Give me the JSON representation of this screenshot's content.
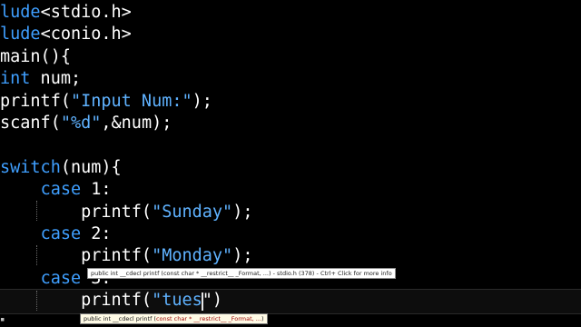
{
  "editor": {
    "lines": [
      {
        "prefix": "",
        "keyword": "lude",
        "rest": "<stdio.h>",
        "str": "",
        "tail": ""
      },
      {
        "prefix": "",
        "keyword": "lude",
        "rest": "<conio.h>",
        "str": "",
        "tail": ""
      },
      {
        "prefix": "main(){",
        "keyword": "",
        "rest": "",
        "str": "",
        "tail": ""
      },
      {
        "prefix": "",
        "keyword": "int",
        "rest": " num;",
        "str": "",
        "tail": ""
      },
      {
        "prefix": "printf(",
        "keyword": "",
        "rest": "",
        "str": "\"Input Num:\"",
        "tail": ");"
      },
      {
        "prefix": "scanf(",
        "keyword": "",
        "rest": "",
        "str": "\"%d\"",
        "tail": ",&num);"
      },
      {
        "prefix": "",
        "keyword": "",
        "rest": "",
        "str": "",
        "tail": ""
      },
      {
        "prefix": "",
        "keyword": "switch",
        "rest": "(num){",
        "str": "",
        "tail": ""
      },
      {
        "prefix": "    ",
        "keyword": "case",
        "rest": " 1:",
        "str": "",
        "tail": ""
      },
      {
        "prefix": "        printf(",
        "keyword": "",
        "rest": "",
        "str": "\"Sunday\"",
        "tail": ");"
      },
      {
        "prefix": "    ",
        "keyword": "case",
        "rest": " 2:",
        "str": "",
        "tail": ""
      },
      {
        "prefix": "        printf(",
        "keyword": "",
        "rest": "",
        "str": "\"Monday\"",
        "tail": ");"
      },
      {
        "prefix": "    ",
        "keyword": "case",
        "rest": " 3:",
        "str": "",
        "tail": ""
      },
      {
        "prefix": "        printf(",
        "keyword": "",
        "rest": "",
        "str": "\"tues",
        "tail": "\")"
      }
    ]
  },
  "tooltips": {
    "hover_text": "public int __cdecl printf (const char * __restrict__ _Format, ...) - stdio.h (378) - Ctrl+ Click for more info",
    "param_before": "public int __cdecl printf (",
    "param_highlight": "const char * __restrict__ _Format, ...",
    "param_after": ")"
  },
  "colors": {
    "background": "#000000",
    "keyword": "#3f9fff",
    "string": "#5fb2ff",
    "text": "#ffffff"
  }
}
